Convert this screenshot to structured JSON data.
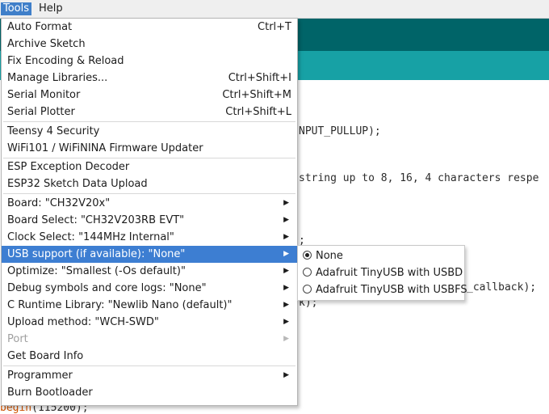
{
  "menubar": {
    "tools": "Tools",
    "help": "Help"
  },
  "editor": {
    "line1": "NPUT_PULLUP);",
    "line2": "string up to 8, 16, 4 characters respe",
    "line3": ";",
    "line4": "_callback);",
    "line5": "k);",
    "line6a": "begin",
    "line6b": "(115200);"
  },
  "tools_menu": {
    "auto_format": {
      "label": "Auto Format",
      "shortcut": "Ctrl+T"
    },
    "archive_sketch": {
      "label": "Archive Sketch"
    },
    "fix_encoding": {
      "label": "Fix Encoding & Reload"
    },
    "manage_libraries": {
      "label": "Manage Libraries...",
      "shortcut": "Ctrl+Shift+I"
    },
    "serial_monitor": {
      "label": "Serial Monitor",
      "shortcut": "Ctrl+Shift+M"
    },
    "serial_plotter": {
      "label": "Serial Plotter",
      "shortcut": "Ctrl+Shift+L"
    },
    "teensy_security": {
      "label": "Teensy 4 Security"
    },
    "wifi_updater": {
      "label": "WiFi101 / WiFiNINA Firmware Updater"
    },
    "esp_decoder": {
      "label": "ESP Exception Decoder"
    },
    "esp32_upload": {
      "label": "ESP32 Sketch Data Upload"
    },
    "board": {
      "label": "Board: \"CH32V20x\""
    },
    "board_select": {
      "label": "Board Select: \"CH32V203RB EVT\""
    },
    "clock_select": {
      "label": "Clock Select: \"144MHz Internal\""
    },
    "usb_support": {
      "label": "USB support (if available): \"None\""
    },
    "optimize": {
      "label": "Optimize: \"Smallest (-Os default)\""
    },
    "debug_symbols": {
      "label": "Debug symbols and core logs: \"None\""
    },
    "c_runtime": {
      "label": "C Runtime Library: \"Newlib Nano (default)\""
    },
    "upload_method": {
      "label": "Upload method: \"WCH-SWD\""
    },
    "port": {
      "label": "Port"
    },
    "get_board_info": {
      "label": "Get Board Info"
    },
    "programmer": {
      "label": "Programmer"
    },
    "burn_bootloader": {
      "label": "Burn Bootloader"
    },
    "submenu_arrow": "▶"
  },
  "usb_submenu": {
    "selected": "None",
    "options": [
      "None",
      "Adafruit TinyUSB with USBD",
      "Adafruit TinyUSB with USBFS"
    ]
  }
}
